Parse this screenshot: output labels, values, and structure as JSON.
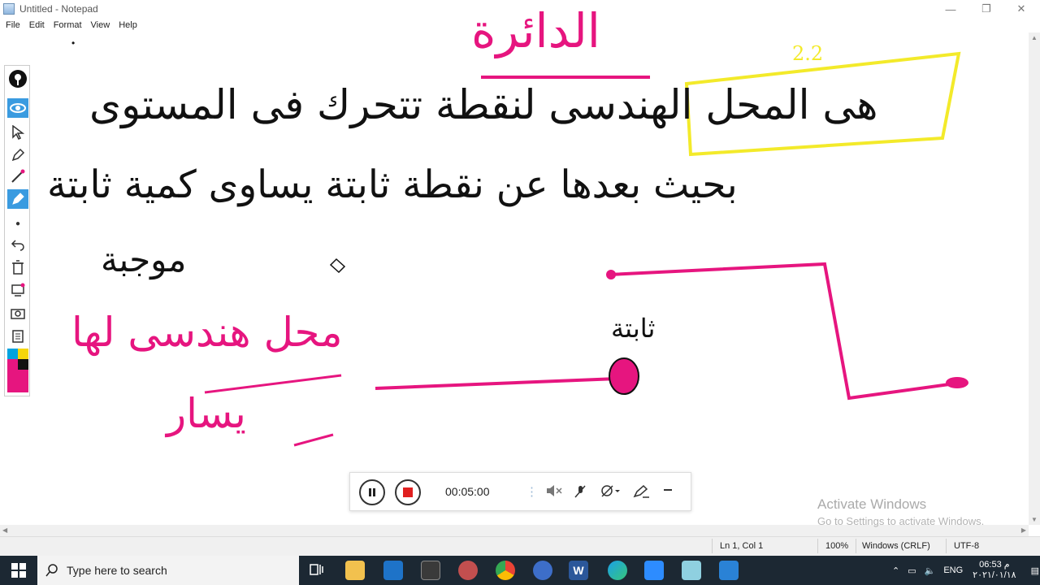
{
  "window": {
    "title": "Untitled - Notepad",
    "minimize_glyph": "—",
    "maximize_glyph": "❐",
    "close_glyph": "✕"
  },
  "menu": {
    "items": [
      "File",
      "Edit",
      "Format",
      "View",
      "Help"
    ]
  },
  "editor": {
    "cursor_dot": "•"
  },
  "status": {
    "position": "Ln 1, Col 1",
    "zoom": "100%",
    "line_ending": "Windows (CRLF)",
    "encoding": "UTF-8"
  },
  "watermark": {
    "line1": "Activate Windows",
    "line2": "Go to Settings to activate Windows."
  },
  "recorder": {
    "time": "00:05:00"
  },
  "annotations": {
    "heading": "الدائرة",
    "note": "2.2",
    "line1": "هى المحل الهندسى لنقطة تتحرك فى المستوى",
    "line2": "بحيث بعدها عن نقطة ثابتة يساوى كمية ثابتة",
    "line3": "موجبة",
    "side_a": "محل هندسى لها",
    "side_b": "يسار",
    "label_point": "ثابتة"
  },
  "taskbar": {
    "search_placeholder": "Type here to search",
    "lang": "ENG",
    "time": "06:53",
    "am_pm": "م",
    "date": "٢٠٢١/٠١/١٨"
  },
  "colors": {
    "ink_black": "#111111",
    "ink_pink": "#e6157f",
    "highlight_yellow": "#f3ea2a",
    "tool_active": "#3a9be0"
  }
}
